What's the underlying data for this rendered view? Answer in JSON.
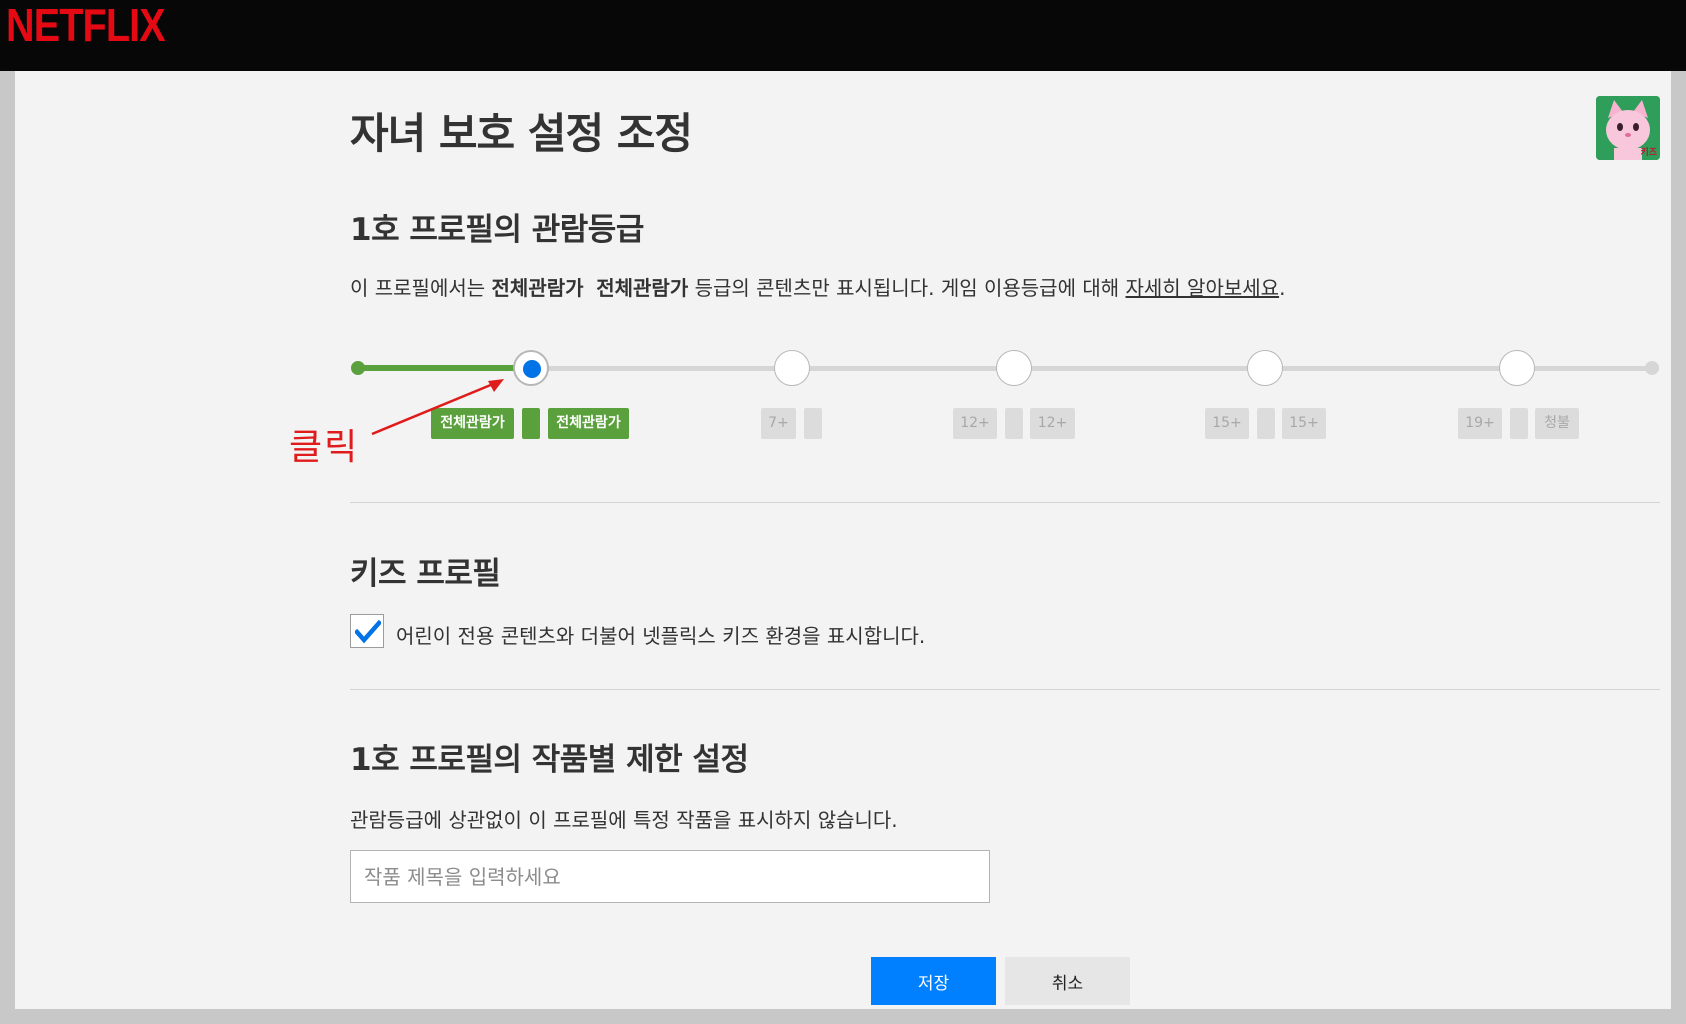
{
  "header": {
    "logo_text": "NETFLIX"
  },
  "avatar": {
    "label": "키즈"
  },
  "page_title": "자녀 보호 설정 조정",
  "rating_section": {
    "title": "1호 프로필의 관람등급",
    "desc_prefix": "이 프로필에서는 ",
    "desc_bold_1": "전체관람가",
    "desc_bold_2": "전체관람가",
    "desc_middle": " 등급의 콘텐츠만 표시됩니다. 게임 이용등급에 대해 ",
    "desc_link": "자세히 알아보세요",
    "desc_suffix": ".",
    "selected_index": 0,
    "levels": [
      {
        "badges": [
          "전체관람가",
          "",
          "전체관람가"
        ]
      },
      {
        "badges": [
          "7+",
          ""
        ]
      },
      {
        "badges": [
          "12+",
          "",
          "12+"
        ]
      },
      {
        "badges": [
          "15+",
          "",
          "15+"
        ]
      },
      {
        "badges": [
          "19+",
          "",
          "청불"
        ]
      }
    ]
  },
  "annotation": {
    "text": "클릭"
  },
  "kids_section": {
    "title": "키즈 프로필",
    "checked": true,
    "checkbox_label": "어린이 전용 콘텐츠와 더불어 넷플릭스 키즈 환경을 표시합니다."
  },
  "restriction_section": {
    "title": "1호 프로필의 작품별 제한 설정",
    "desc": "관람등급에 상관없이 이 프로필에 특정 작품을 표시하지 않습니다.",
    "input_placeholder": "작품 제목을 입력하세요",
    "input_value": ""
  },
  "buttons": {
    "save": "저장",
    "cancel": "취소"
  },
  "colors": {
    "accent": "#0080ff",
    "rating_green": "#5aa03c",
    "brand_red": "#e50914",
    "annotation_red": "#e01b1b"
  }
}
